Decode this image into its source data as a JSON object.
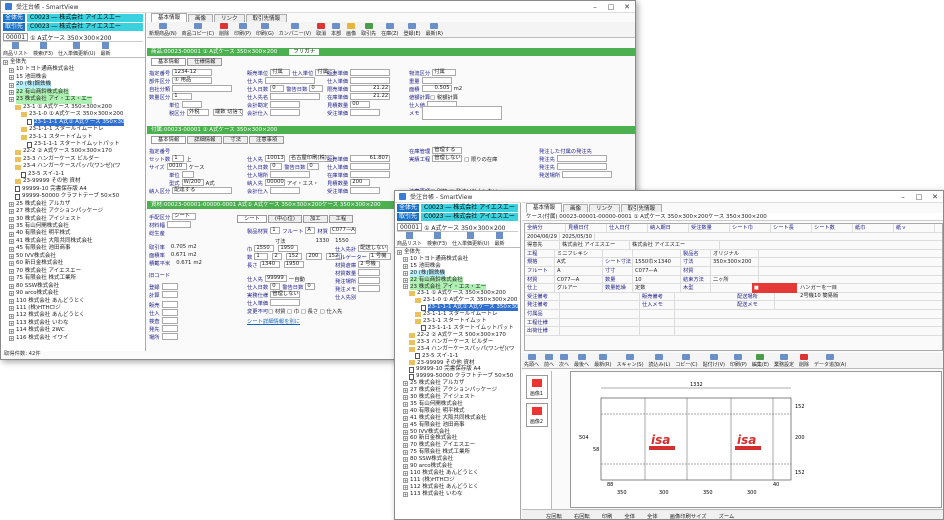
{
  "w1": {
    "title": "受注台帳 - SmartView",
    "sel_label1": "全体先",
    "sel_value1": "C0023 ― 株式会社 アイエスエー",
    "sel_label2": "取引先",
    "sel_value2": "C0023 ― 株式会社 アイエスエー",
    "code_value": "00001",
    "code_desc": "① A式ケース 350×300×200",
    "ltools": [
      "商品リスト",
      "検索(F3)",
      "仕入単価更新(U)",
      "最新"
    ],
    "tree": [
      {
        "t": "全体先",
        "lvl": 0,
        "k": "ex",
        "st": ""
      },
      {
        "t": "10 トヨト通商株式会社",
        "lvl": 1,
        "k": "ex",
        "st": ""
      },
      {
        "t": "15 池田株会",
        "lvl": 1,
        "k": "ex",
        "st": ""
      },
      {
        "t": "20 (株)鋼鉄機",
        "lvl": 1,
        "k": "ex",
        "st": "cy"
      },
      {
        "t": "22 有山商鈴株式会社",
        "lvl": 1,
        "k": "ex",
        "st": "hl"
      },
      {
        "t": "23 株式会社 アイ・エス・エー",
        "lvl": 1,
        "k": "ex",
        "st": "hl"
      },
      {
        "t": "23-1 ① A式ケース 350×300×200",
        "lvl": 2,
        "k": "fi",
        "st": ""
      },
      {
        "t": "23-1-0 ① A式ケース 350×300×200",
        "lvl": 3,
        "k": "fi",
        "st": ""
      },
      {
        "t": "23-1-1-1 A式① A式ケース 350×30",
        "lvl": 4,
        "k": "rf",
        "st": "sel"
      },
      {
        "t": "23-1-1-1 スタールイムートレ",
        "lvl": 3,
        "k": "fi",
        "st": ""
      },
      {
        "t": "23-1-1 スタートイムット",
        "lvl": 3,
        "k": "fi",
        "st": ""
      },
      {
        "t": "23-1-1-1 スタートイムットパット",
        "lvl": 4,
        "k": "rf",
        "st": ""
      },
      {
        "t": "22-2 ② A式ケース 500×300×170",
        "lvl": 2,
        "k": "fi",
        "st": ""
      },
      {
        "t": "23-3 ハンガーケース ビルダー",
        "lvl": 2,
        "k": "fi",
        "st": ""
      },
      {
        "t": "23-4 ハンガーケースパッパ(ワンゼ)(ワ",
        "lvl": 2,
        "k": "fi",
        "st": ""
      },
      {
        "t": "23-5 スイ-1-1",
        "lvl": 3,
        "k": "rf",
        "st": ""
      },
      {
        "t": "23-99999 その他 資材",
        "lvl": 2,
        "k": "fi",
        "st": ""
      },
      {
        "t": "99999-10 完書保存版 A4",
        "lvl": 2,
        "k": "rf",
        "st": ""
      },
      {
        "t": "99999-50000 クラフトテープ 50×50",
        "lvl": 2,
        "k": "rf",
        "st": ""
      },
      {
        "t": "25 株式会社 アルカザ",
        "lvl": 1,
        "k": "ex",
        "st": ""
      },
      {
        "t": "27 株式会社 アクションパッケージ",
        "lvl": 1,
        "k": "ex",
        "st": ""
      },
      {
        "t": "30 株式会社 アイジェスト",
        "lvl": 1,
        "k": "ex",
        "st": ""
      },
      {
        "t": "35 有山何開株式会社",
        "lvl": 1,
        "k": "ex",
        "st": ""
      },
      {
        "t": "40 有限会社 明平株式",
        "lvl": 1,
        "k": "ex",
        "st": ""
      },
      {
        "t": "41 株式会社 大阪共同株式会社",
        "lvl": 1,
        "k": "ex",
        "st": ""
      },
      {
        "t": "45 有限会社 池田商事",
        "lvl": 1,
        "k": "ex",
        "st": ""
      },
      {
        "t": "50 IVV株式会社",
        "lvl": 1,
        "k": "ex",
        "st": ""
      },
      {
        "t": "60 新日金株式会社",
        "lvl": 1,
        "k": "ex",
        "st": ""
      },
      {
        "t": "70 株式会社 アイエスエー",
        "lvl": 1,
        "k": "ex",
        "st": ""
      },
      {
        "t": "75 有限会社 株式工業所",
        "lvl": 1,
        "k": "ex",
        "st": ""
      },
      {
        "t": "80 SSW株式会社",
        "lvl": 1,
        "k": "ex",
        "st": ""
      },
      {
        "t": "90 arco株式会社",
        "lvl": 1,
        "k": "ex",
        "st": ""
      },
      {
        "t": "110 株式会社 あんどうとく",
        "lvl": 1,
        "k": "ex",
        "st": ""
      },
      {
        "t": "111 (株)HTHロジ",
        "lvl": 1,
        "k": "ex",
        "st": ""
      },
      {
        "t": "112 株式会社 あんどうとく",
        "lvl": 1,
        "k": "ex",
        "st": ""
      },
      {
        "t": "113 株式会社 いわな",
        "lvl": 1,
        "k": "ex",
        "st": ""
      },
      {
        "t": "114 株式会社 2WC",
        "lvl": 1,
        "k": "ex",
        "st": ""
      },
      {
        "t": "116 株式会社 イワイ",
        "lvl": 1,
        "k": "ex",
        "st": ""
      }
    ],
    "status": "取得件数: 42件",
    "tabs": [
      "基本情報",
      "画像",
      "リンク",
      "取引先情報"
    ],
    "toolbar": [
      "新規商品(N)",
      "商品コピー(C)",
      "削除",
      "印刷(P)",
      "印刷(G)",
      "カンパニー(V)",
      "取消",
      "本部",
      "画像",
      "取引先",
      "在庫(Z)",
      "登録(E)",
      "最新(R)"
    ],
    "sect1": "商品:00023-00001 ① A式ケース 350×300×200",
    "sect1_kana": "フリガナ",
    "subtabs1": [
      "基本情報",
      "仕様情報"
    ],
    "f": {
      "code_l": "指定番号",
      "code_v": "1234-12",
      "cat_l": "部件区分",
      "cat_v": "① 用品",
      "own_l": "自社分類",
      "lot_l": "数量区分",
      "lot_v": "1",
      "unit_l": "単位",
      "tax_l": "税区分",
      "tax_v": "外税",
      "tax2": "端数 切捨て",
      "sale_unit_l": "販売単位",
      "sale_unit_v": "付属",
      "buy_unit_l": "仕入単位",
      "buy_unit_v": "付属",
      "buy_l": "仕入先",
      "days_l": "仕入日数",
      "days_v": "0",
      "warn_l": "警告日数",
      "warn_v": "0",
      "buyer_l": "仕入先名",
      "acct_l": "会計勘定",
      "acct_l2": "会計仕入",
      "sprice_l": "販売単価",
      "bprice_l": "仕入単価",
      "bprice_v": "",
      "sale_l": "限売単価",
      "sale_v": "21.22",
      "stock_l": "在庫単価",
      "stock_v": "21.22",
      "est_l": "見積数量",
      "est_v": "00",
      "cost_l": "受注単価",
      "cost_v": "",
      "slim_l": "警備数",
      "kind_l": "物流区分",
      "kind_v": "付属",
      "weight_l": "重量",
      "area_l": "面積",
      "area_v": "0.505",
      "area_u": "m2",
      "calc_l": "値額計算",
      "calc_v": "□ 税額計算",
      "val_l": "仕入値",
      "memo_l": "メモ"
    },
    "sect2": "付属:00023-00001 ① A式ケース 350×300×200",
    "subtabs2": [
      "基本情報",
      "詳細情報",
      "寸法",
      "注意事項"
    ],
    "f2": {
      "no_l": "指定番号",
      "set_l": "セット数",
      "set_v": "1",
      "set_u": "上",
      "size_l": "サイズ",
      "size_v": "0010",
      "size_u": "ケース",
      "unit_l": "単位",
      "spec_l": "型式",
      "spec_v": "W/200",
      "spec2": "A式",
      "deliv_l": "納入区分",
      "deliv_v": "配達する",
      "buy_l": "仕入先",
      "buy_v": "10013",
      "buy_n": "名古屋印刷(株)",
      "days_l": "仕入日数",
      "days_v": "0",
      "warn_l": "警告日数",
      "warn_v": "0",
      "place_l": "仕入場所",
      "lot_l": "納入先",
      "lot_v": "00000",
      "lot_n": "アイ・エス・",
      "acct_l": "会計仕入",
      "sale_l": "販売単価",
      "sale_v": "61.807",
      "buy2_l": "仕入単価",
      "stock_l": "在庫単価",
      "est_l": "見積数量",
      "est_v": "200",
      "recv_l": "受注単価",
      "mng_l": "在庫管理",
      "mng_v": "管理する",
      "ret_l": "実績工程",
      "ret_v": "管理しない",
      "ret_c": "□ 限りの在庫",
      "note_l": "注意事項",
      "note_v": "□ 別物 □ 発注は計上しない",
      "order_l": "発注した付属の発注先",
      "o1": "発注先",
      "o2": "発注先",
      "o3": "発送場所"
    },
    "sect3": "資材:00023-00001-00000-0001 A式① A式ケース 350×300×200ケース 350×300×200",
    "subtabs3": [
      "シート",
      "(中心位)",
      "加工",
      "工程"
    ],
    "f3": {
      "note_l": "手配区分",
      "note_v": "シート",
      "gw_l": "材料幅",
      "gw_v": "",
      "tw_l": "総生産",
      "tr_l": "取引率",
      "tr_v": "0.705",
      "tr_u": "m2",
      "ur_l": "面積率",
      "ur_v": "0.671",
      "ur_u": "m2",
      "rr_l": "積載平米",
      "rr_v": "0.671",
      "rr_u": "m2",
      "bc_l": "旧コード",
      "s1": "登録",
      "s2": "計算",
      "s3": "販売",
      "s4": "仕入",
      "s5": "検査",
      "s6": "発先",
      "s7": "場所",
      "paper_l": "製品材質",
      "paper_v": "1",
      "flute_l": "フルート",
      "flute_v": "A",
      "mat_l": "材質",
      "mat_v": "C077—A",
      "dim_l": "寸法",
      "w_l": "巾",
      "w_v": "1550",
      "w2": "1950",
      "len_l": "長さ",
      "len_v": "1340",
      "len2": "1950",
      "l1": "1330",
      "l2": "1550",
      "mk_l": "数",
      "mk_v": "1",
      "mk2": "2",
      "mk3": "152",
      "mk4": "200",
      "mk5": "152",
      "buy_l": "仕入先",
      "buy_v": "99999",
      "buy_n": "一自動",
      "bd_l": "仕入日数",
      "bd_v": "0",
      "wd_l": "警告日数",
      "wd_v": "0",
      "pl_l": "実務仕様",
      "pl_v": "管理しない",
      "cs_l": "仕入単価",
      "cb_l": "変更不可",
      "cb_v": "□ 材質 □ 巾 □ 長さ □ 仕入先",
      "lk": "シート詳細情報を別に",
      "w_key": "仕入先計",
      "ct_l": "ゴルゲーター",
      "ct_v": "1 号機",
      "pk_l": "材質倉庫",
      "pk_v": "2 号機",
      "pr_l": "材質数量",
      "ord_l": "発注場所",
      "ord2_l": "発注メモ",
      "kind_l": "仕入先別",
      "kind_v": "配送しない"
    }
  },
  "w2": {
    "title": "受注台帳 - SmartView",
    "sel_label1": "全体先",
    "sel_value1": "C0023 ― 株式会社 アイエスエー",
    "sel_label2": "取引先",
    "sel_value2": "C0023 ― 株式会社 アイエスエー",
    "code_value": "00001",
    "code_desc": "① A式ケース 350×300×200",
    "ltools": [
      "商品リスト",
      "検索(F3)",
      "仕入単価更新(U)",
      "最新"
    ],
    "tabs": [
      "基本情報",
      "画像",
      "リンク",
      "取引先情報"
    ],
    "header": "ケース(付属) 00023-00001-00000-0001 ① A式ケース 350×300×200ケース 350×300×200",
    "g_headers": [
      "全納分",
      "見積日付",
      "仕入日付",
      "納入期日",
      "受注数量",
      "シート巾",
      "シート長",
      "シート数",
      "紙巾",
      "紙ｖ"
    ],
    "g_row1": [
      "2004/06/29",
      "2025/05/30"
    ],
    "g_row2": [
      "得意先",
      "",
      "株式会社 アイエスエー",
      "",
      "株式会社 アイエスエー"
    ],
    "g_rows": [
      {
        "l": "工程",
        "v": "ミニフレキシ",
        "l2": "",
        "v2": "",
        "l3": "製品名",
        "v3": "オリジナル"
      },
      {
        "l": "規格",
        "v": "A式",
        "l2": "シート寸法",
        "v2": "1550巾×1340",
        "l3": "寸法",
        "v3": "350×300×200"
      },
      {
        "l": "フルート",
        "v": "A",
        "l2": "寸寸",
        "v2": "C077—A",
        "l3": "材質",
        "v3": ""
      },
      {
        "l": "材質",
        "v": "C077—A",
        "l2": "数量",
        "v2": "10",
        "l3": "結束方法",
        "v3": "二ヶ所"
      },
      {
        "l": "仕上",
        "v": "グルアー",
        "l2": "数量乾燥",
        "v2": "定数",
        "l3": "木型",
        "v3": ""
      }
    ],
    "lower_labels": [
      "受注備考",
      "発注備考",
      "付属品",
      "工程仕様",
      "出荷仕様"
    ],
    "lower_labels2": [
      "販売備考",
      "仕入メモ",
      "",
      "",
      ""
    ],
    "lower_right": [
      "配送場所",
      "配送メモ"
    ],
    "special": "ハンガーを一目",
    "special2": "2号機10 簡易版",
    "toolbar2": [
      "先頭へ",
      "前へ",
      "次へ",
      "最後へ",
      "最新(R)",
      "スキャン(S)",
      "読込み(L)",
      "コピー(C)",
      "貼付け(V)",
      "印刷(P)",
      "編集(E)",
      "業務設定",
      "削除",
      "データ追加(A)"
    ],
    "thumbs": [
      "画像1",
      "画像2"
    ],
    "drawing": {
      "top_total": "1332",
      "left_h": "504",
      "right_h": "152",
      "labels": [
        "152",
        "200",
        "152"
      ],
      "bottom": [
        "350",
        "300",
        "350",
        "300"
      ],
      "b2": "58",
      "b3": "88",
      "b4": "40",
      "logo": "isa"
    },
    "bbar": [
      "左回転",
      "右回転",
      "印刷",
      "全体",
      "全体",
      "画像印刷サイズ",
      "ズーム"
    ],
    "tree_repeat": "w1"
  }
}
